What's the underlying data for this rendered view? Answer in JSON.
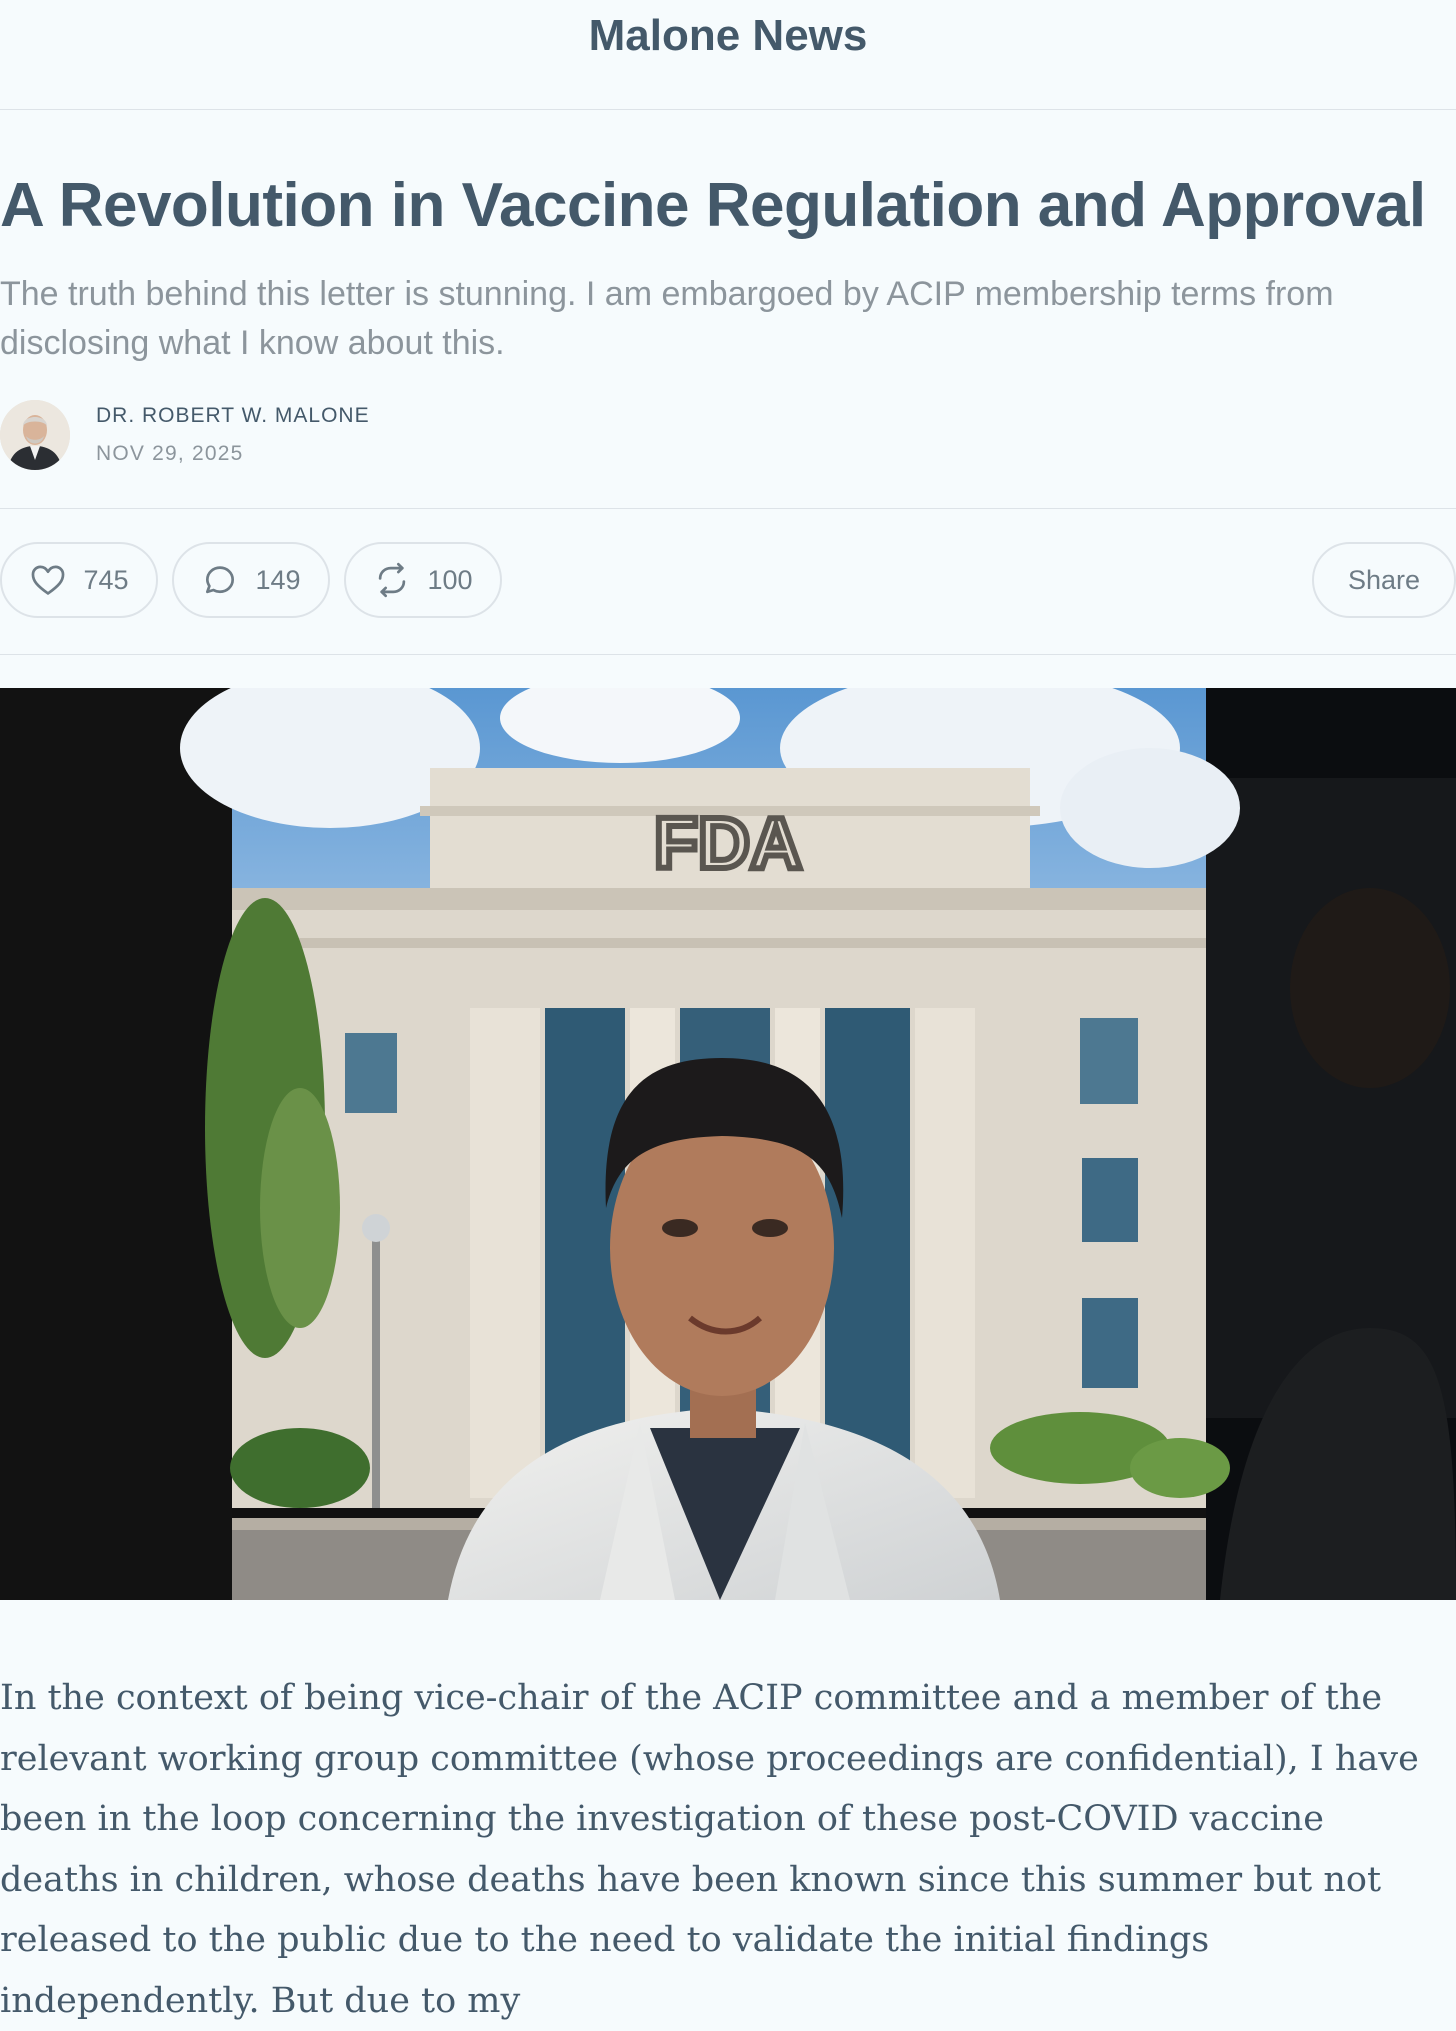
{
  "header": {
    "publication": "Malone News"
  },
  "post": {
    "title": "A Revolution in Vaccine Regulation and Approval",
    "subtitle": "The truth behind this letter is stunning. I am embargoed by ACIP membership terms from disclosing what I know about this.",
    "author": "DR. ROBERT W. MALONE",
    "date": "NOV 29, 2025",
    "hero_sign": "FDA",
    "body": "In the context of being vice-chair of the ACIP committee and a member of the relevant working group committee (whose proceedings are confidential), I have been in the loop concerning the investigation of these post-COVID vaccine deaths in children, whose deaths have been known since this summer but not released to the public due to the need to validate the initial findings independently. But due to my"
  },
  "actions": {
    "likes": "745",
    "comments": "149",
    "restacks": "100",
    "share_label": "Share"
  },
  "colors": {
    "background": "#f6fbfd",
    "heading": "#44596a",
    "muted": "#8c959c",
    "border": "#dde3e8"
  },
  "icons": [
    "heart-icon",
    "comment-icon",
    "restack-icon"
  ]
}
